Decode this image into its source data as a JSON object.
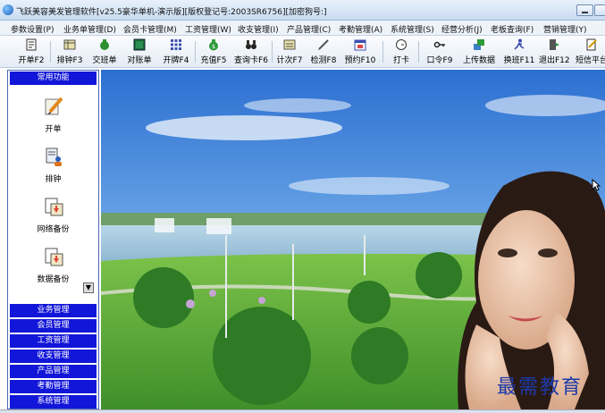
{
  "window": {
    "title": "飞跃美容美发管理软件[v25.5豪华单机-演示版][版权登记号:2003SR6756][加密狗号:]"
  },
  "menubar": {
    "items": [
      "参数设置(P)",
      "业务单管理(D)",
      "会员卡管理(M)",
      "工资管理(W)",
      "收支管理(I)",
      "产品管理(C)",
      "考勤管理(A)",
      "系统管理(S)",
      "经营分析(J)",
      "老板查询(F)",
      "营销管理(Y)"
    ]
  },
  "toolbar": {
    "buttons": [
      {
        "label": "开单F2",
        "icon": "open-bill-icon"
      },
      {
        "label": "排钟F3",
        "icon": "schedule-icon"
      },
      {
        "label": "交班单",
        "icon": "shift-report-icon"
      },
      {
        "label": "对账单",
        "icon": "statement-icon"
      },
      {
        "label": "开牌F4",
        "icon": "card-grid-icon"
      },
      {
        "label": "充值F5",
        "icon": "money-bag-icon"
      },
      {
        "label": "查询卡F6",
        "icon": "binoculars-icon"
      },
      {
        "label": "计次F7",
        "icon": "count-icon"
      },
      {
        "label": "检测F8",
        "icon": "pen-icon"
      },
      {
        "label": "预约F10",
        "icon": "calendar-icon"
      },
      {
        "label": "打卡",
        "icon": "clock-icon"
      },
      {
        "label": "口令F9",
        "icon": "key-icon"
      },
      {
        "label": "上传数据",
        "icon": "upload-icon"
      },
      {
        "label": "换班F11",
        "icon": "run-icon"
      },
      {
        "label": "退出F12",
        "icon": "exit-icon"
      },
      {
        "label": "短信平台",
        "icon": "sms-icon"
      }
    ]
  },
  "sidebar": {
    "header": "常用功能",
    "items": [
      {
        "label": "开单",
        "icon": "edit-pencil-icon"
      },
      {
        "label": "排钟",
        "icon": "schedule-person-icon"
      },
      {
        "label": "网络备份",
        "icon": "network-backup-icon"
      },
      {
        "label": "数据备份",
        "icon": "data-backup-icon"
      }
    ],
    "categories": [
      "业务管理",
      "会员管理",
      "工资管理",
      "收支管理",
      "产品管理",
      "考勤管理",
      "系统管理"
    ]
  },
  "watermark": "最需教育",
  "colors": {
    "sidebar_header": "#1216d8",
    "sky_top": "#2c6fd1",
    "grass": "#3f8f2a"
  }
}
